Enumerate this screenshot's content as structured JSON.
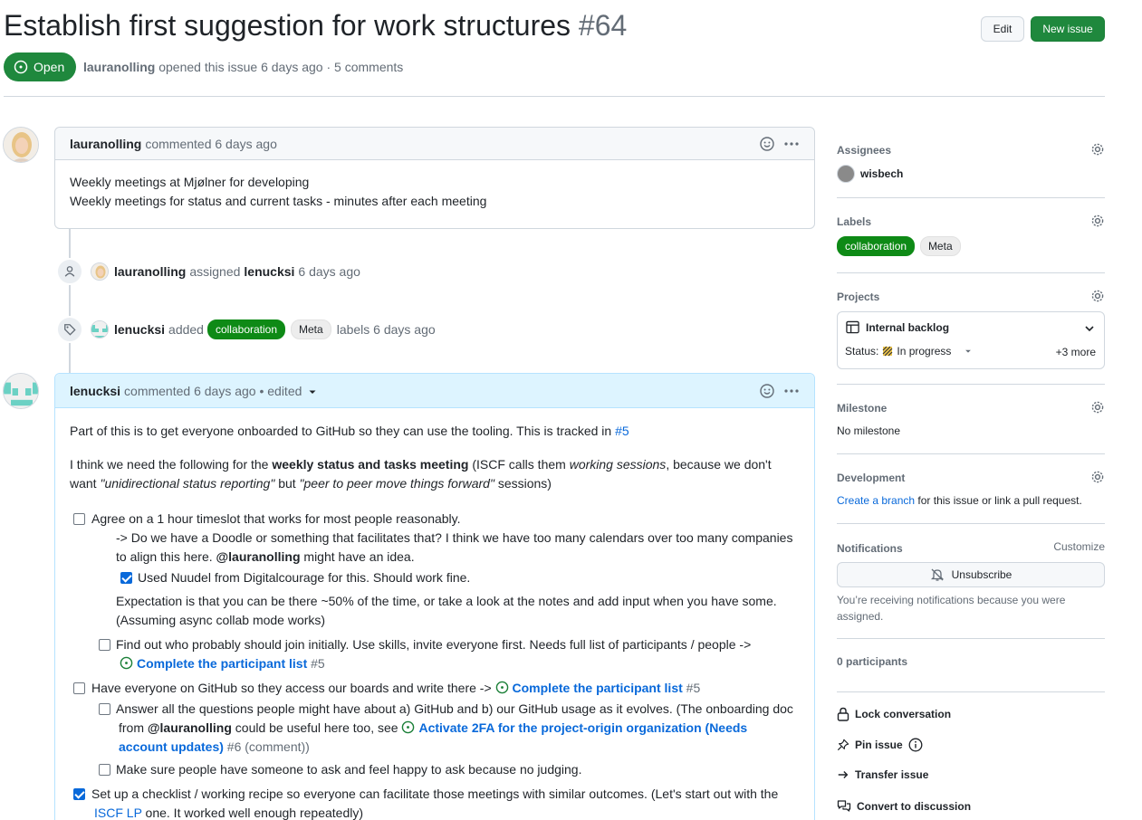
{
  "issue": {
    "title": "Establish first suggestion for work structures",
    "number": "#64",
    "state": "Open",
    "author": "lauranolling",
    "opened_text": "opened this issue 6 days ago",
    "dot": "·",
    "comments_count": "5 comments"
  },
  "header_buttons": {
    "edit": "Edit",
    "new_issue": "New issue"
  },
  "comment1": {
    "author": "lauranolling",
    "meta": "commented 6 days ago",
    "lines": [
      "Weekly meetings at Mjølner for developing",
      "Weekly meetings for status and current tasks - minutes after each meeting"
    ]
  },
  "event_assign": {
    "actor": "lauranolling",
    "verb": "assigned",
    "target": "lenucksi",
    "time": "6 days ago"
  },
  "event_labels": {
    "actor": "lenucksi",
    "verb": "added",
    "label1": "collaboration",
    "label2": "Meta",
    "suffix": "labels 6 days ago"
  },
  "comment2": {
    "author": "lenucksi",
    "meta": "commented 6 days ago • edited",
    "p1_text": "Part of this is to get everyone onboarded to GitHub so they can use the tooling. This is tracked in",
    "p1_link": "#5",
    "p2_a": "I think we need the following for the",
    "p2_bold": "weekly status and tasks meeting",
    "p2_b": "(ISCF calls them",
    "p2_italic": "working sessions",
    "p2_c": ", because we don't",
    "p2_line2_a": "want",
    "p2_italic2": "\"unidirectional status reporting\"",
    "p2_line2_b": "but",
    "p2_italic3": "\"peer to peer move things forward\"",
    "p2_line2_c": "sessions)",
    "t1": "Agree on a 1 hour timeslot that works for most people reasonably.",
    "t1_sub1": "-> Do we have a Doodle or something that facilitates that? I think we have too many calendars over too many companies",
    "t1_sub2a": "to align this here.",
    "t1_sub2_mention": "@lauranolling",
    "t1_sub2b": "might have an idea.",
    "t1_check": "Used Nuudel from Digitalcourage for this. Should work fine.",
    "t1_exp1": "Expectation is that you can be there ~50% of the time, or take a look at the notes and add input when you have some.",
    "t1_exp2": "(Assuming async collab mode works)",
    "t1b": "Find out who probably should join initially. Use skills, invite everyone first. Needs full list of participants / people ->",
    "t1b_ref": "Complete the participant list",
    "t1b_num": "#5",
    "t2": "Have everyone on GitHub so they access our boards and write there ->",
    "t2_ref": "Complete the participant list",
    "t2_num": "#5",
    "t2a_1": "Answer all the questions people might have about a) GitHub and b) our GitHub usage as it evolves. (The onboarding doc",
    "t2a_2a": "from",
    "t2a_mention": "@lauranolling",
    "t2a_2b": "could be useful here too, see",
    "t2a_ref1": "Activate 2FA for the project-origin organization (Needs",
    "t2a_ref2": "account updates)",
    "t2a_num": "#6",
    "t2a_paren": "(comment))",
    "t2b": "Make sure people have someone to ask and feel happy to ask because no judging.",
    "t3": "Set up a checklist / working recipe so everyone can facilitate those meetings with similar outcomes. (Let's start out with the",
    "t3_link": "ISCF LP",
    "t3_rest": "one. It worked well enough repeatedly)"
  },
  "sidebar": {
    "assignees_label": "Assignees",
    "assignee": "wisbech",
    "labels_label": "Labels",
    "label1": "collaboration",
    "label2": "Meta",
    "projects_label": "Projects",
    "project_name": "Internal backlog",
    "project_status_label": "Status:",
    "project_status_value": "In progress",
    "project_more": "+3 more",
    "milestone_label": "Milestone",
    "milestone_value": "No milestone",
    "development_label": "Development",
    "dev_link": "Create a branch",
    "dev_text": "for this issue or link a pull request.",
    "notifications_label": "Notifications",
    "customize": "Customize",
    "unsubscribe": "Unsubscribe",
    "notif_reason1": "You’re receiving notifications because you were",
    "notif_reason2": "assigned.",
    "participants": "0 participants",
    "lock": "Lock conversation",
    "pin": "Pin issue",
    "transfer": "Transfer issue",
    "convert": "Convert to discussion"
  },
  "colors": {
    "green": "#1f883d",
    "label_collab": "#0e8a16",
    "link": "#0969da"
  }
}
